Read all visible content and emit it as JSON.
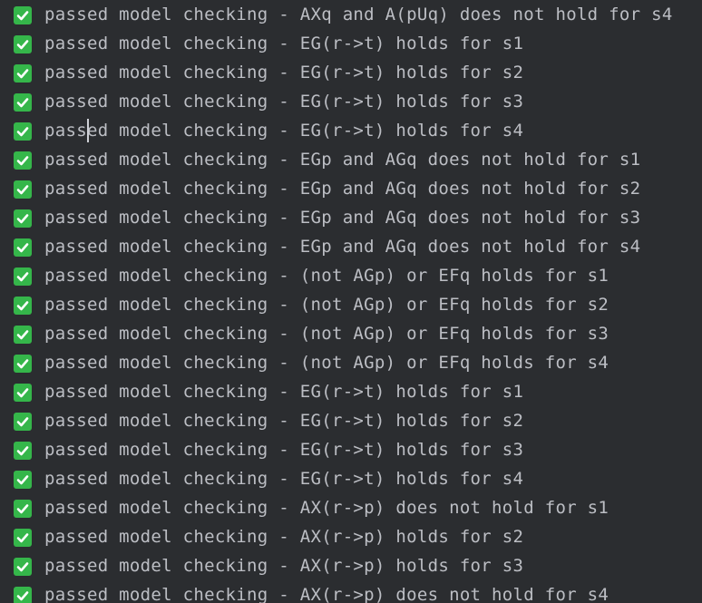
{
  "console": {
    "lines": [
      "passed model checking - AXq and A(pUq) does not hold for s4",
      "passed model checking - EG(r->t) holds for s1",
      "passed model checking - EG(r->t) holds for s2",
      "passed model checking - EG(r->t) holds for s3",
      "passed model checking - EG(r->t) holds for s4",
      "passed model checking - EGp and AGq does not hold for s1",
      "passed model checking - EGp and AGq does not hold for s2",
      "passed model checking - EGp and AGq does not hold for s3",
      "passed model checking - EGp and AGq does not hold for s4",
      "passed model checking - (not AGp) or EFq holds for s1",
      "passed model checking - (not AGp) or EFq holds for s2",
      "passed model checking - (not AGp) or EFq holds for s3",
      "passed model checking - (not AGp) or EFq holds for s4",
      "passed model checking - EG(r->t) holds for s1",
      "passed model checking - EG(r->t) holds for s2",
      "passed model checking - EG(r->t) holds for s3",
      "passed model checking - EG(r->t) holds for s4",
      "passed model checking - AX(r->p) does not hold for s1",
      "passed model checking - AX(r->p) holds for s2",
      "passed model checking - AX(r->p) holds for s3",
      "passed model checking - AX(r->p) does not hold for s4"
    ],
    "status_icon": "check-mark-icon"
  },
  "colors": {
    "background": "#2b2d30",
    "text": "#bcbec4",
    "check_badge": "#35b64a"
  }
}
